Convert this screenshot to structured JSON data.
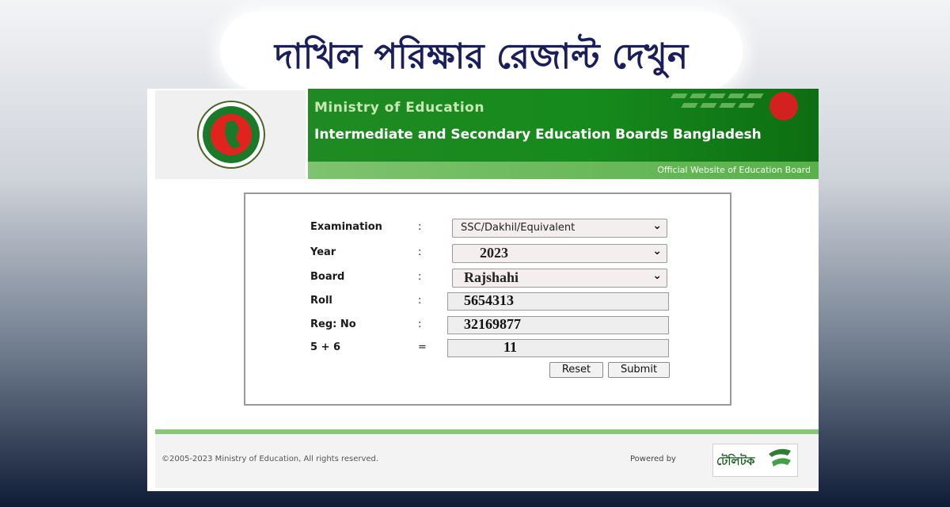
{
  "banner": {
    "title": "দাখিল পরিক্ষার রেজাল্ট দেখুন"
  },
  "header": {
    "ministry": "Ministry of Education",
    "boards": "Intermediate and Secondary Education Boards Bangladesh",
    "official": "Official Website of Education Board",
    "logo_icon": "bangladesh-government-seal"
  },
  "form": {
    "fields": [
      {
        "label": "Examination",
        "sep": ":",
        "value": "SSC/Dakhil/Equivalent"
      },
      {
        "label": "Year",
        "sep": ":",
        "value": "2023"
      },
      {
        "label": "Board",
        "sep": ":",
        "value": "Rajshahi"
      },
      {
        "label": "Roll",
        "sep": ":",
        "value": "5654313"
      },
      {
        "label": "Reg: No",
        "sep": ":",
        "value": "32169877"
      },
      {
        "label": "5 + 6",
        "sep": "=",
        "value": "11"
      }
    ],
    "reset_label": "Reset",
    "submit_label": "Submit"
  },
  "footer": {
    "copyright": "©2005-2023 Ministry of Education, All rights reserved.",
    "powered_by": "Powered by",
    "teletalk": "টেলিটক"
  },
  "colors": {
    "green": "#168a1c",
    "navy": "#1a1f5c"
  }
}
